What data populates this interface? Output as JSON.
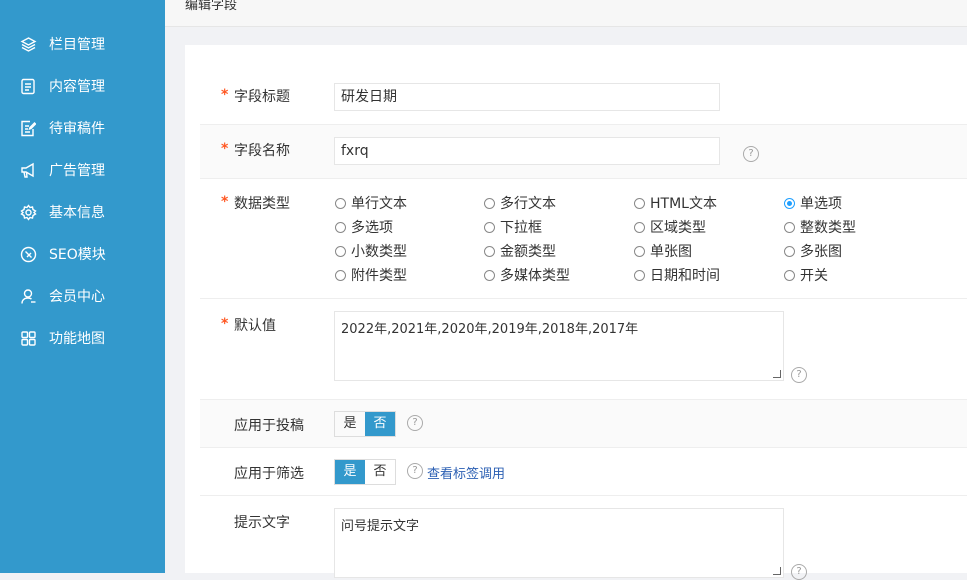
{
  "sidebar": {
    "items": [
      {
        "label": "栏目管理",
        "icon": "layers-icon"
      },
      {
        "label": "内容管理",
        "icon": "document-icon"
      },
      {
        "label": "待审稿件",
        "icon": "edit-document-icon"
      },
      {
        "label": "广告管理",
        "icon": "megaphone-icon"
      },
      {
        "label": "基本信息",
        "icon": "gear-icon"
      },
      {
        "label": "SEO模块",
        "icon": "seo-icon"
      },
      {
        "label": "会员中心",
        "icon": "user-icon"
      },
      {
        "label": "功能地图",
        "icon": "grid-icon"
      }
    ]
  },
  "header": {
    "title": "编辑字段"
  },
  "form": {
    "field_title": {
      "label": "字段标题",
      "value": "研发日期"
    },
    "field_name": {
      "label": "字段名称",
      "value": "fxrq"
    },
    "data_type": {
      "label": "数据类型",
      "options": [
        "单行文本",
        "多行文本",
        "HTML文本",
        "单选项",
        "多选项",
        "下拉框",
        "区域类型",
        "整数类型",
        "小数类型",
        "金额类型",
        "单张图",
        "多张图",
        "附件类型",
        "多媒体类型",
        "日期和时间",
        "开关"
      ],
      "selected": "单选项"
    },
    "default_value": {
      "label": "默认值",
      "value": "2022年,2021年,2020年,2019年,2018年,2017年"
    },
    "apply_submission": {
      "label": "应用于投稿",
      "yes": "是",
      "no": "否",
      "selected": "否"
    },
    "apply_filter": {
      "label": "应用于筛选",
      "yes": "是",
      "no": "否",
      "selected": "是",
      "link": "查看标签调用"
    },
    "hint_text": {
      "label": "提示文字",
      "value": "问号提示文字"
    },
    "required_mark": "*",
    "help_mark": "?"
  },
  "colors": {
    "sidebar_bg": "#3399cc",
    "accent": "#1e9fff",
    "required": "#ff5722"
  }
}
